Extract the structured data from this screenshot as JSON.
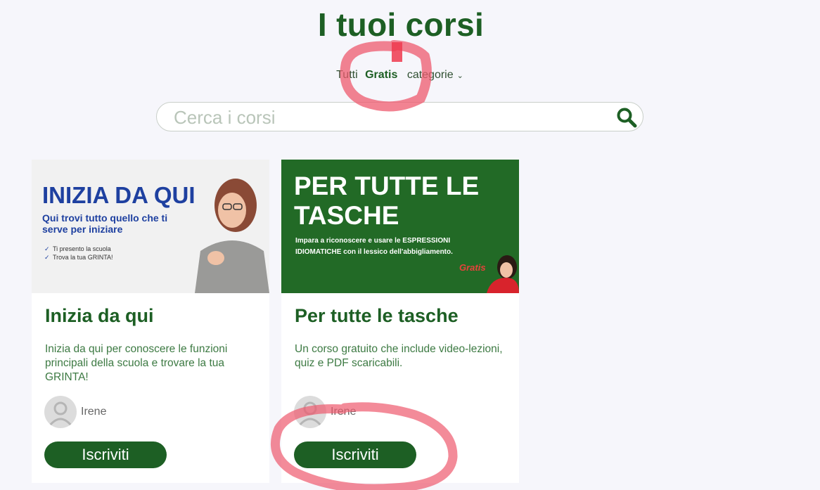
{
  "header": {
    "title": "I tuoi corsi"
  },
  "filters": {
    "all": "Tutti",
    "free": "Gratis",
    "categories": "categorie",
    "caret": "⌄"
  },
  "search": {
    "placeholder": "Cerca i corsi",
    "value": ""
  },
  "courses": [
    {
      "image": {
        "headline": "INIZIA DA QUI",
        "subline_1": "Qui trovi tutto quello che ti",
        "subline_2": "serve per iniziare",
        "check_1": "Ti presento la scuola",
        "check_2": "Trova la tua GRINTA!"
      },
      "title": "Inizia da qui",
      "description": "Inizia da qui per conoscere le funzioni principali della scuola e trovare la tua GRINTA!",
      "author": "Irene",
      "button": "Iscriviti"
    },
    {
      "image": {
        "headline_1": "PER TUTTE LE",
        "headline_2": "TASCHE",
        "subline_1": "Impara a riconoscere e usare le ESPRESSIONI",
        "subline_2": "IDIOMATICHE con il lessico dell'abbigliamento.",
        "badge": "Gratis"
      },
      "title": "Per tutte le tasche",
      "description": "Un corso gratuito che include video-lezioni, quiz e PDF scaricabili.",
      "author": "Irene",
      "button": "Iscriviti"
    }
  ],
  "colors": {
    "brand_green": "#1d5f24",
    "background": "#f6f6fb",
    "card_image_blue": "#1e40a0",
    "annotation_red": "#ee5a6e"
  }
}
